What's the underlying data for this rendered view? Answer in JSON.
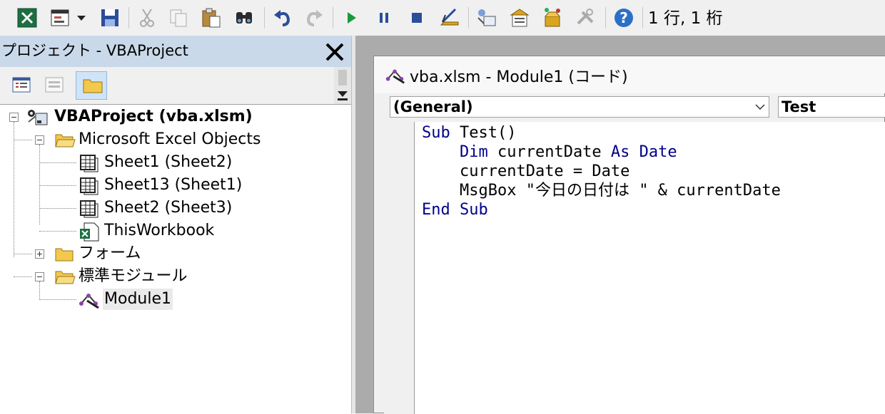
{
  "toolbar": {
    "cursor_position": "1 行, 1 桁",
    "icons": [
      "excel-view-icon",
      "insert-userform-icon",
      "dropdown-arrow-icon",
      "save-icon",
      "cut-icon",
      "copy-icon",
      "paste-icon",
      "find-icon",
      "undo-icon",
      "redo-icon",
      "run-icon",
      "break-icon",
      "reset-icon",
      "design-mode-icon",
      "project-explorer-icon",
      "properties-icon",
      "object-browser-icon",
      "toolbox-icon",
      "help-icon"
    ]
  },
  "project_panel": {
    "title": "プロジェクト - VBAProject",
    "tree": {
      "root": "VBAProject (vba.xlsm)",
      "excel_objects": "Microsoft Excel Objects",
      "sheets": [
        "Sheet1 (Sheet2)",
        "Sheet13 (Sheet1)",
        "Sheet2 (Sheet3)"
      ],
      "workbook": "ThisWorkbook",
      "forms": "フォーム",
      "modules_folder": "標準モジュール",
      "module": "Module1"
    }
  },
  "code_window": {
    "title": "vba.xlsm - Module1 (コード)",
    "object_dropdown": "(General)",
    "procedure_dropdown": "Test",
    "lines": [
      {
        "kw": "Sub",
        "rest": " Test()",
        "indent": ""
      },
      {
        "kw": "Dim",
        "rest": " currentDate ",
        "kw2": "As Date",
        "indent": "    "
      },
      {
        "kw": "",
        "rest": "currentDate = Date",
        "indent": "    "
      },
      {
        "kw": "",
        "rest": "MsgBox \"今日の日付は \" & currentDate",
        "indent": "    "
      },
      {
        "kw": "End Sub",
        "rest": "",
        "indent": ""
      }
    ]
  },
  "colors": {
    "keyword": "#00008b",
    "title_bar": "#c9d9ea",
    "selected_tool": "#cfe4f7"
  }
}
